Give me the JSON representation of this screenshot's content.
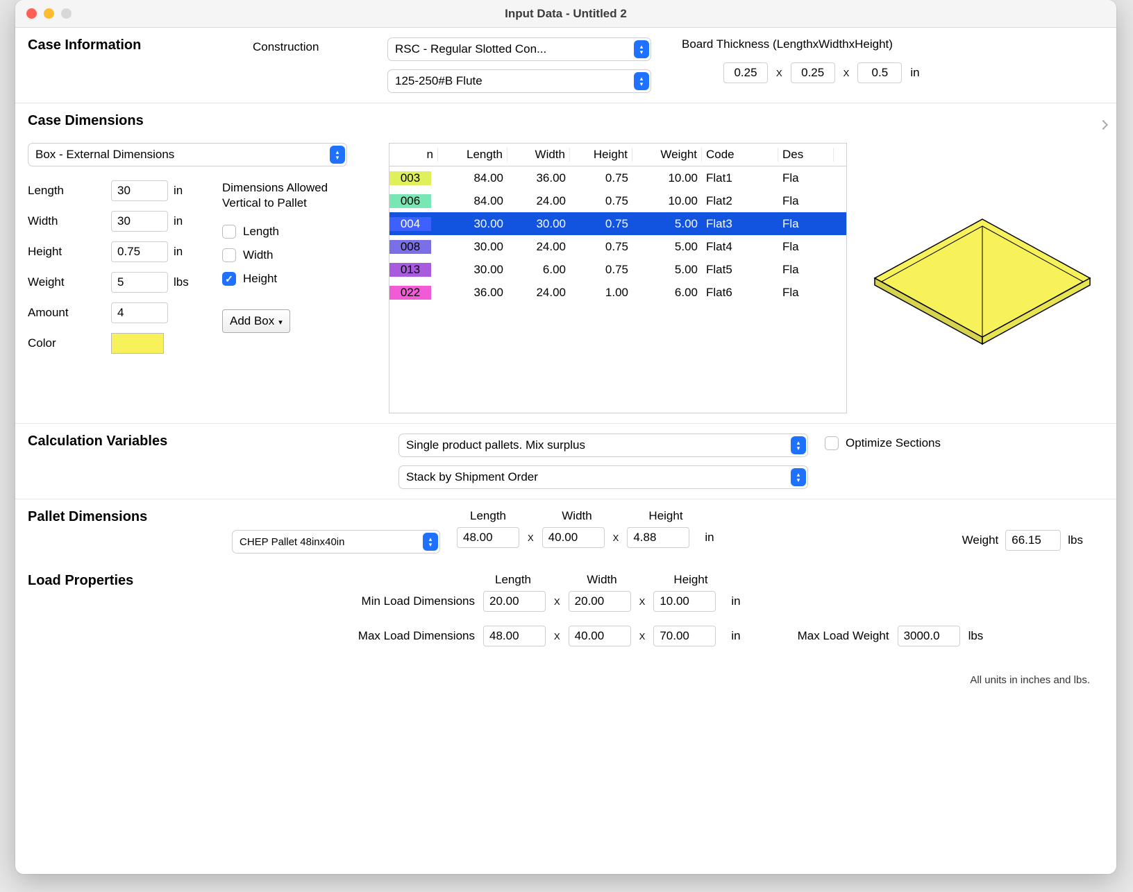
{
  "window": {
    "title": "Input Data - Untitled 2"
  },
  "caseInfo": {
    "title": "Case Information",
    "constructionLabel": "Construction",
    "constructionValue": "RSC - Regular Slotted Con...",
    "fluteValue": "125-250#B Flute",
    "boardThicknessLabel": "Board Thickness (LengthxWidthxHeight)",
    "thickL": "0.25",
    "thickW": "0.25",
    "thickH": "0.5",
    "x": "X",
    "unit": "in"
  },
  "caseDim": {
    "title": "Case Dimensions",
    "boxTypeValue": "Box - External Dimensions",
    "labels": {
      "length": "Length",
      "width": "Width",
      "height": "Height",
      "weight": "Weight",
      "amount": "Amount",
      "color": "Color"
    },
    "length": "30",
    "lengthUnit": "in",
    "width": "30",
    "widthUnit": "in",
    "height": "0.75",
    "heightUnit": "in",
    "weight": "5",
    "weightUnit": "lbs",
    "amount": "4",
    "allowedLabel": "Dimensions Allowed Vertical to Pallet",
    "chkLength": "Length",
    "chkWidth": "Width",
    "chkHeight": "Height",
    "addBox": "Add Box",
    "table": {
      "headers": [
        "n",
        "Length",
        "Width",
        "Height",
        "Weight",
        "Code",
        "Des"
      ],
      "rows": [
        {
          "n": "003",
          "length": "84.00",
          "width": "36.00",
          "height": "0.75",
          "weight": "10.00",
          "code": "Flat1",
          "des": "Fla"
        },
        {
          "n": "006",
          "length": "84.00",
          "width": "24.00",
          "height": "0.75",
          "weight": "10.00",
          "code": "Flat2",
          "des": "Fla"
        },
        {
          "n": "004",
          "length": "30.00",
          "width": "30.00",
          "height": "0.75",
          "weight": "5.00",
          "code": "Flat3",
          "des": "Fla",
          "selected": true
        },
        {
          "n": "008",
          "length": "30.00",
          "width": "24.00",
          "height": "0.75",
          "weight": "5.00",
          "code": "Flat4",
          "des": "Fla"
        },
        {
          "n": "013",
          "length": "30.00",
          "width": "6.00",
          "height": "0.75",
          "weight": "5.00",
          "code": "Flat5",
          "des": "Fla"
        },
        {
          "n": "022",
          "length": "36.00",
          "width": "24.00",
          "height": "1.00",
          "weight": "6.00",
          "code": "Flat6",
          "des": "Fla"
        }
      ]
    }
  },
  "calc": {
    "title": "Calculation Variables",
    "mode": "Single product pallets. Mix surplus",
    "stack": "Stack by Shipment Order",
    "optimize": "Optimize Sections"
  },
  "pallet": {
    "title": "Pallet Dimensions",
    "type": "CHEP Pallet 48inx40in",
    "lwh": {
      "l": "Length",
      "w": "Width",
      "h": "Height"
    },
    "length": "48.00",
    "width": "40.00",
    "height": "4.88",
    "unit": "in",
    "weightLabel": "Weight",
    "weight": "66.15",
    "weightUnit": "lbs"
  },
  "load": {
    "title": "Load Properties",
    "minLabel": "Min Load Dimensions",
    "maxLabel": "Max Load Dimensions",
    "lwh": {
      "l": "Length",
      "w": "Width",
      "h": "Height"
    },
    "minL": "20.00",
    "minW": "20.00",
    "minH": "10.00",
    "unit": "in",
    "maxL": "48.00",
    "maxW": "40.00",
    "maxH": "70.00",
    "maxWeightLabel": "Max Load Weight",
    "maxWeight": "3000.0",
    "weightUnit": "lbs"
  },
  "footer": {
    "note": "All units in inches and lbs."
  },
  "x": "X"
}
